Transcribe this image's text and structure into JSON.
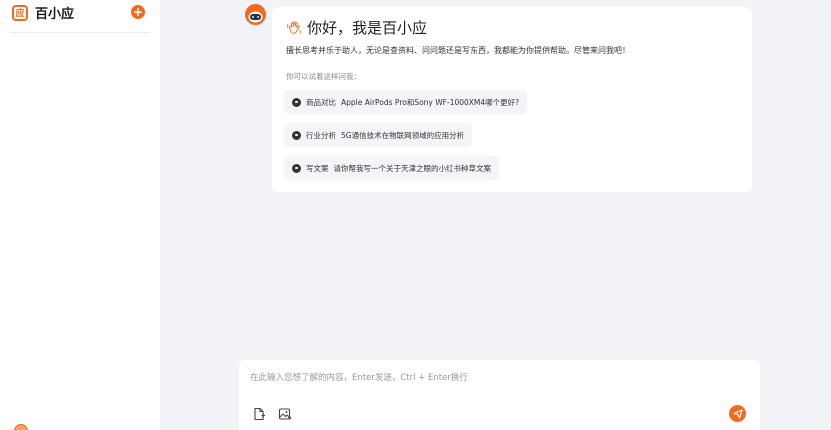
{
  "sidebar": {
    "brand_logo_char": "应",
    "brand_name": "百小应",
    "new_chat_symbol": "+"
  },
  "message": {
    "greeting": "你好，我是百小应",
    "intro": "擅长思考并乐于助人，无论是查资料、问问题还是写东西，我都能为你提供帮助。尽管来问我吧！",
    "try_label": "你可以试着这样问我：",
    "suggestions": [
      {
        "category": "商品对比",
        "text": "Apple AirPods Pro和Sony WF-1000XM4哪个更好?"
      },
      {
        "category": "行业分析",
        "text": "5G通信技术在物联网领域的应用分析"
      },
      {
        "category": "写文案",
        "text": "请你帮我写一个关于天津之眼的小红书种草文案"
      }
    ]
  },
  "input": {
    "placeholder": "在此输入您想了解的内容，Enter发送，Ctrl + Enter换行",
    "value": ""
  },
  "colors": {
    "accent": "#f26b1d",
    "background": "#f2f3f7",
    "card": "#ffffff"
  },
  "icons": [
    "plus-icon",
    "wave-hand-icon",
    "chat-bubble-icon",
    "file-upload-icon",
    "image-upload-icon",
    "send-icon"
  ]
}
